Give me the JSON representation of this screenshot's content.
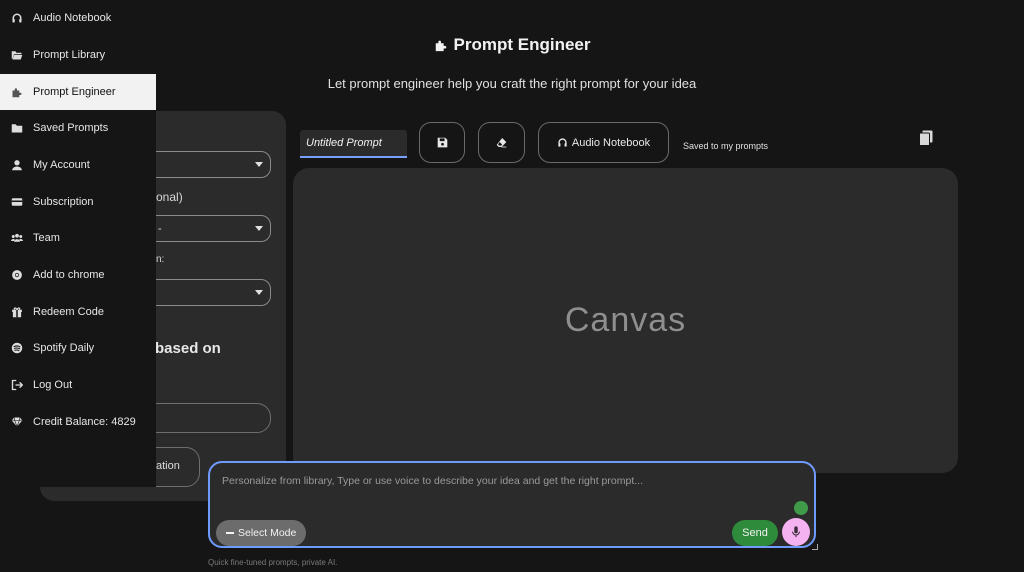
{
  "header": {
    "title": "Prompt Engineer",
    "subtitle": "Let prompt engineer help you craft the right prompt for your idea"
  },
  "sidebar": {
    "items": [
      {
        "label": "Audio Notebook",
        "icon": "headphones-icon"
      },
      {
        "label": "Prompt Library",
        "icon": "folder-open-icon"
      },
      {
        "label": "Prompt Engineer",
        "icon": "puzzle-icon",
        "active": true
      },
      {
        "label": "Saved Prompts",
        "icon": "folder-icon"
      },
      {
        "label": "My Account",
        "icon": "user-icon"
      },
      {
        "label": "Subscription",
        "icon": "credit-card-icon"
      },
      {
        "label": "Team",
        "icon": "team-icon"
      },
      {
        "label": "Add to chrome",
        "icon": "chrome-icon"
      },
      {
        "label": "Redeem Code",
        "icon": "gift-icon"
      },
      {
        "label": "Spotify Daily",
        "icon": "spotify-icon"
      },
      {
        "label": "Log Out",
        "icon": "logout-icon"
      },
      {
        "label": "Credit Balance: 4829",
        "icon": "gem-icon"
      }
    ]
  },
  "config_panel": {
    "optional_label": "onal)",
    "select_2_value": "-",
    "label_3": "n:",
    "heading": "based on",
    "button_label": "ation"
  },
  "toolbar": {
    "title_value": "Untitled Prompt",
    "audio_notebook_label": "Audio Notebook",
    "saved_status": "Saved to my prompts"
  },
  "canvas": {
    "label": "Canvas"
  },
  "composer": {
    "placeholder": "Personalize from library, Type or use voice to describe your idea and get the right prompt...",
    "select_mode_label": "Select Mode",
    "send_label": "Send"
  },
  "footer": {
    "text": "Quick fine-tuned prompts, private AI."
  },
  "colors": {
    "background": "#151515",
    "panel": "#2b2b2b",
    "accent_border": "#6f9bff",
    "send": "#2f8b3c",
    "mic": "#f4b3f0"
  }
}
